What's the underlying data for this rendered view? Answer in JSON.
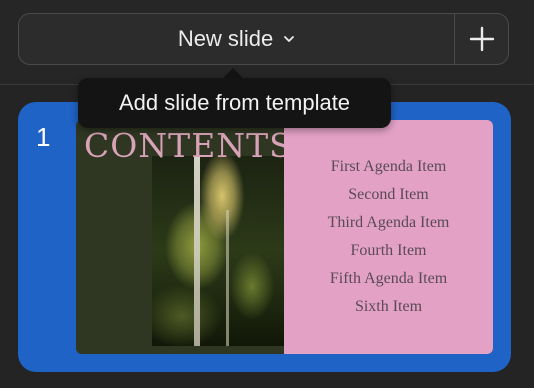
{
  "toolbar": {
    "new_slide_label": "New slide",
    "dropdown_icon": "chevron-down-icon",
    "add_icon": "plus-icon"
  },
  "tooltip": {
    "text": "Add slide from template"
  },
  "slides": [
    {
      "number": "1",
      "title": "CONTENTS",
      "agenda": [
        "First Agenda Item",
        "Second Item",
        "Third Agenda Item",
        "Fourth Item",
        "Fifth Agenda Item",
        "Sixth Item"
      ]
    }
  ],
  "colors": {
    "selection": "#1f63c6",
    "slide_right_panel": "#e3a1c6",
    "slide_left_panel": "#2f3622",
    "title_text": "#d8a3b8"
  }
}
